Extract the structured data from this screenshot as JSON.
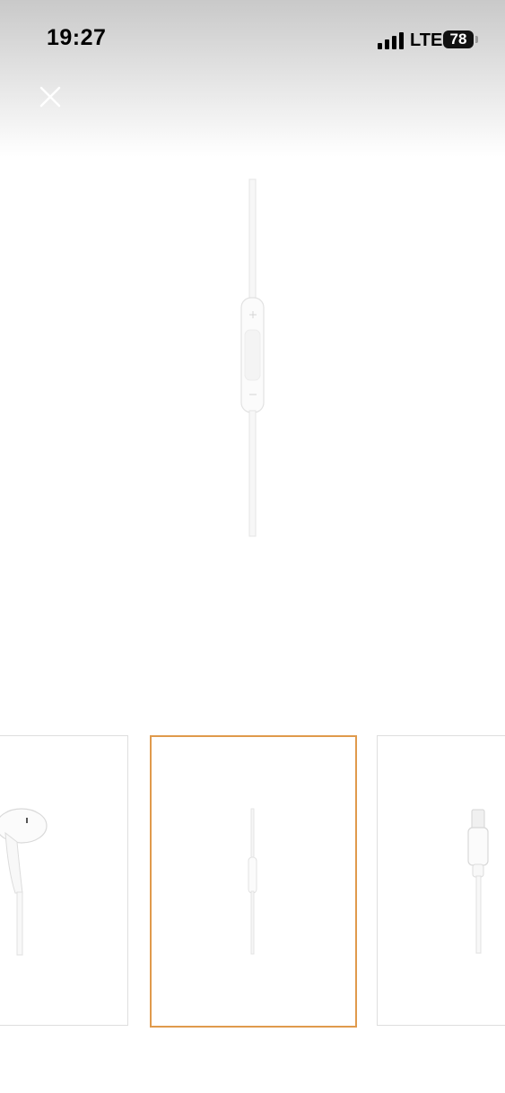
{
  "status_bar": {
    "time": "19:27",
    "network": "LTE",
    "battery_percent": "78",
    "signal_bars": 4
  },
  "viewer": {
    "close_icon": "close-icon",
    "main_image": "earpods-remote-image",
    "selected_thumbnail_index": 1,
    "thumbnails": [
      {
        "image": "earbud-image"
      },
      {
        "image": "remote-image"
      },
      {
        "image": "lightning-connector-image"
      }
    ]
  },
  "colors": {
    "selected_border": "#e09a4c",
    "thumb_border": "#dedede"
  }
}
